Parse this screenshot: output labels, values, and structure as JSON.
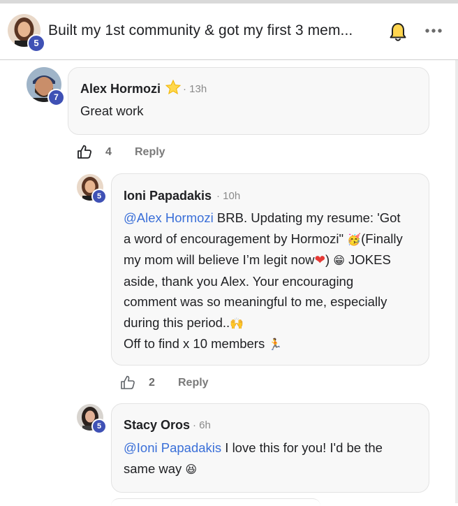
{
  "post": {
    "title": "Built my 1st community & got my first 3 mem...",
    "author_level": "5"
  },
  "comments": [
    {
      "author": "Alex Hormozi",
      "star": "⭐",
      "time": "13h",
      "level": "7",
      "text": "Great work",
      "likes": "4",
      "reply_label": "Reply"
    },
    {
      "author": "Ioni Papadakis",
      "time": "10h",
      "level": "5",
      "mention": "@Alex Hormozi",
      "line1_rest": " BRB. Updating my resume: 'Got",
      "line2": "a word of encouragement by Hormozi\"",
      "line2_emoji": "🥳",
      "line2_rest": "(Finally",
      "line3": "my mom will believe I’m legit now",
      "line3_heart": "❤",
      "line3_mid": ") ",
      "line3_emoji": "😁",
      "line3_rest": " JOKES",
      "line4": "aside, thank you Alex. Your encouraging",
      "line5": "comment was so meaningful to me, especially",
      "line6": "during this period..",
      "line6_emoji": "🙌",
      "line7": "Off to find x 10 members ",
      "line7_emoji": "🏃",
      "likes": "2",
      "reply_label": "Reply"
    },
    {
      "author": "Stacy Oros",
      "time": "6h",
      "level": "5",
      "mention": "@Ioni Papadakis",
      "line1_rest": " I love this for you! I'd be the",
      "line2": "same way ",
      "line2_emoji": "😆"
    }
  ],
  "colors": {
    "badge": "#3f51b5",
    "mention": "#3a6fd8",
    "card_bg": "#f8f8f8"
  },
  "icons": [
    "bell-icon",
    "more-options-icon",
    "thumbs-up-icon",
    "star-icon"
  ]
}
